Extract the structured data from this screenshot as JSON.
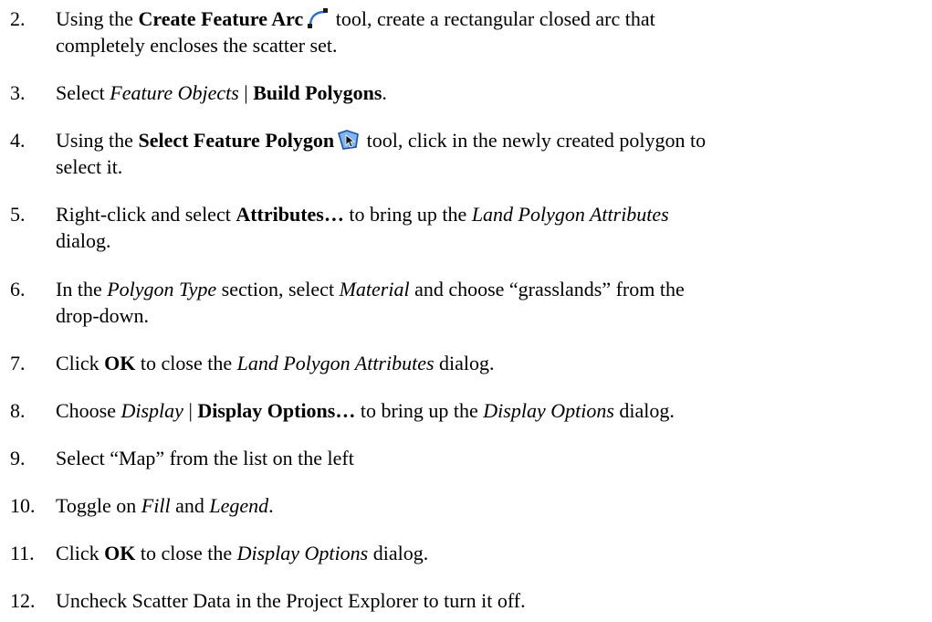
{
  "steps": [
    {
      "number": "2.",
      "action_pre": "Using the ",
      "tool": "Create Feature Arc",
      "icon": "create-feature-arc-icon",
      "line1_post": " tool, create a rectangular closed arc that",
      "line2": "completely encloses the scatter set."
    },
    {
      "number": "3.",
      "pre": "Select ",
      "menu": "Feature Objects",
      "sep": " | ",
      "command": "Build Polygons",
      "post": "."
    },
    {
      "number": "4.",
      "action_pre": "Using the ",
      "tool": "Select Feature Polygon",
      "icon": "select-feature-polygon-icon",
      "line1_post": " tool, click in the newly created polygon to",
      "line2": "select it."
    },
    {
      "number": "5.",
      "pre": "Right-click and select ",
      "command": "Attributes…",
      "mid": " to bring up the ",
      "dialog": "Land Polygon Attributes",
      "line2": "dialog."
    },
    {
      "number": "6.",
      "pre": "In the ",
      "section": "Polygon Type",
      "mid": " section, select ",
      "option": "Material",
      "post": " and choose “grasslands” from the",
      "line2": "drop-down."
    },
    {
      "number": "7.",
      "pre": "Click ",
      "button": "OK",
      "mid": " to close the ",
      "dialog": "Land Polygon Attributes",
      "post": " dialog."
    },
    {
      "number": "8.",
      "pre": "Choose ",
      "menu": "Display",
      "sep": " | ",
      "command": "Display Options…",
      "mid": " to bring up the ",
      "dialog": "Display Options",
      "post": " dialog."
    },
    {
      "number": "9.",
      "text": "Select “Map” from the list on the left"
    },
    {
      "number": "10.",
      "pre": "Toggle on ",
      "opt1": "Fill",
      "mid": " and ",
      "opt2": "Legend",
      "post": "."
    },
    {
      "number": "11.",
      "pre": "Click ",
      "button": "OK",
      "mid": " to close the ",
      "dialog": "Display Options",
      "post": " dialog."
    },
    {
      "number": "12.",
      "text": "Uncheck Scatter Data in the Project Explorer to turn it off."
    }
  ]
}
